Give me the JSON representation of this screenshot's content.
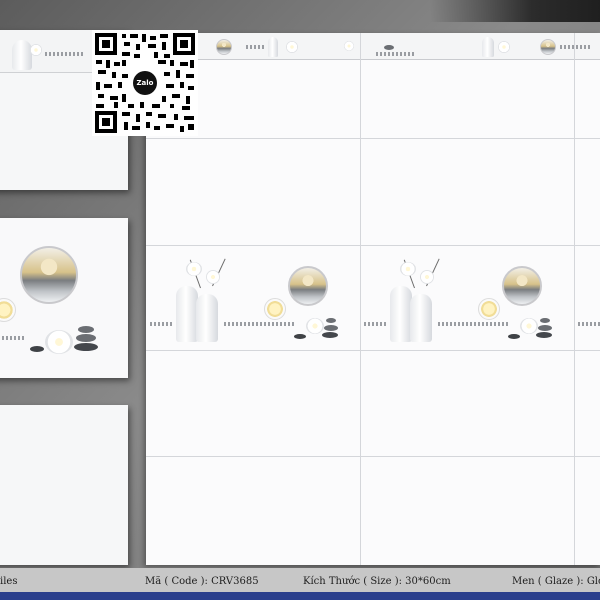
{
  "qr": {
    "badge_text": "Zalo"
  },
  "info_bar": {
    "brand_suffix": "iles",
    "code_label": "Mã ( Code ): CRV3685",
    "size_label": "Kích Thước ( Size ): 30*60cm",
    "glaze_label": "Men ( Glaze ): Glo"
  },
  "colors": {
    "info_bar_bg": "#c7c7c7",
    "accent_strip": "#2b3f8c"
  }
}
